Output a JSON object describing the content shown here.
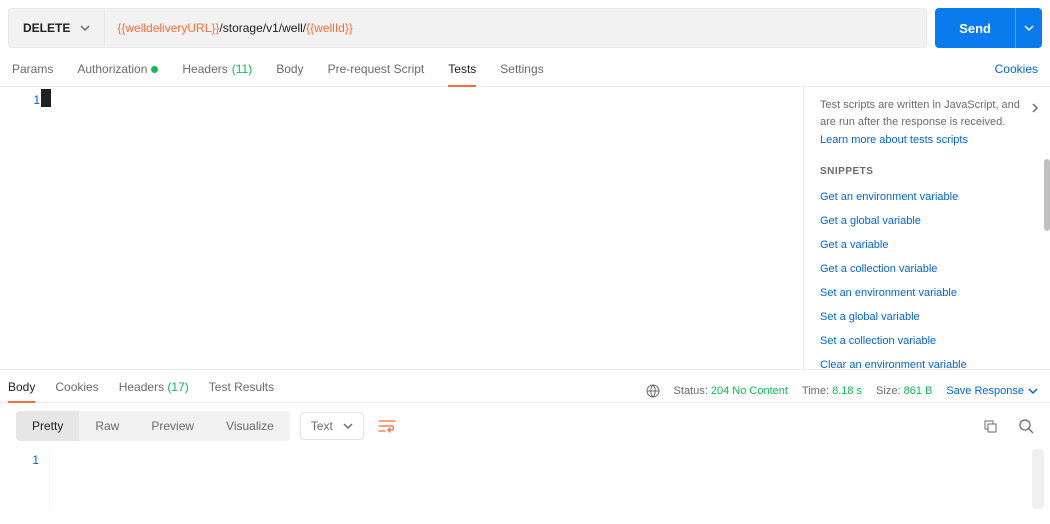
{
  "request": {
    "method": "DELETE",
    "url_var1": "{{welldeliveryURL}}",
    "url_mid": "/storage/v1/well/",
    "url_var2": "{{wellId}}",
    "send_label": "Send"
  },
  "tabs": {
    "params": "Params",
    "authorization": "Authorization",
    "headers": "Headers",
    "headers_count": "(11)",
    "body": "Body",
    "preRequest": "Pre-request Script",
    "tests": "Tests",
    "settings": "Settings",
    "cookies": "Cookies"
  },
  "editor": {
    "line1": "1"
  },
  "sidePanel": {
    "desc": "Test scripts are written in JavaScript, and are run after the response is received.",
    "learn": "Learn more about tests scripts",
    "heading": "SNIPPETS",
    "snippets": [
      "Get an environment variable",
      "Get a global variable",
      "Get a variable",
      "Get a collection variable",
      "Set an environment variable",
      "Set a global variable",
      "Set a collection variable",
      "Clear an environment variable"
    ]
  },
  "respTabs": {
    "body": "Body",
    "cookies": "Cookies",
    "headers": "Headers",
    "headers_count": "(17)",
    "testResults": "Test Results"
  },
  "respMeta": {
    "status_label": "Status:",
    "status_value": "204 No Content",
    "time_label": "Time:",
    "time_value": "8.18 s",
    "size_label": "Size:",
    "size_value": "861 B",
    "save": "Save Response"
  },
  "respView": {
    "pretty": "Pretty",
    "raw": "Raw",
    "preview": "Preview",
    "visualize": "Visualize",
    "lang": "Text"
  },
  "respBody": {
    "line1": "1"
  }
}
